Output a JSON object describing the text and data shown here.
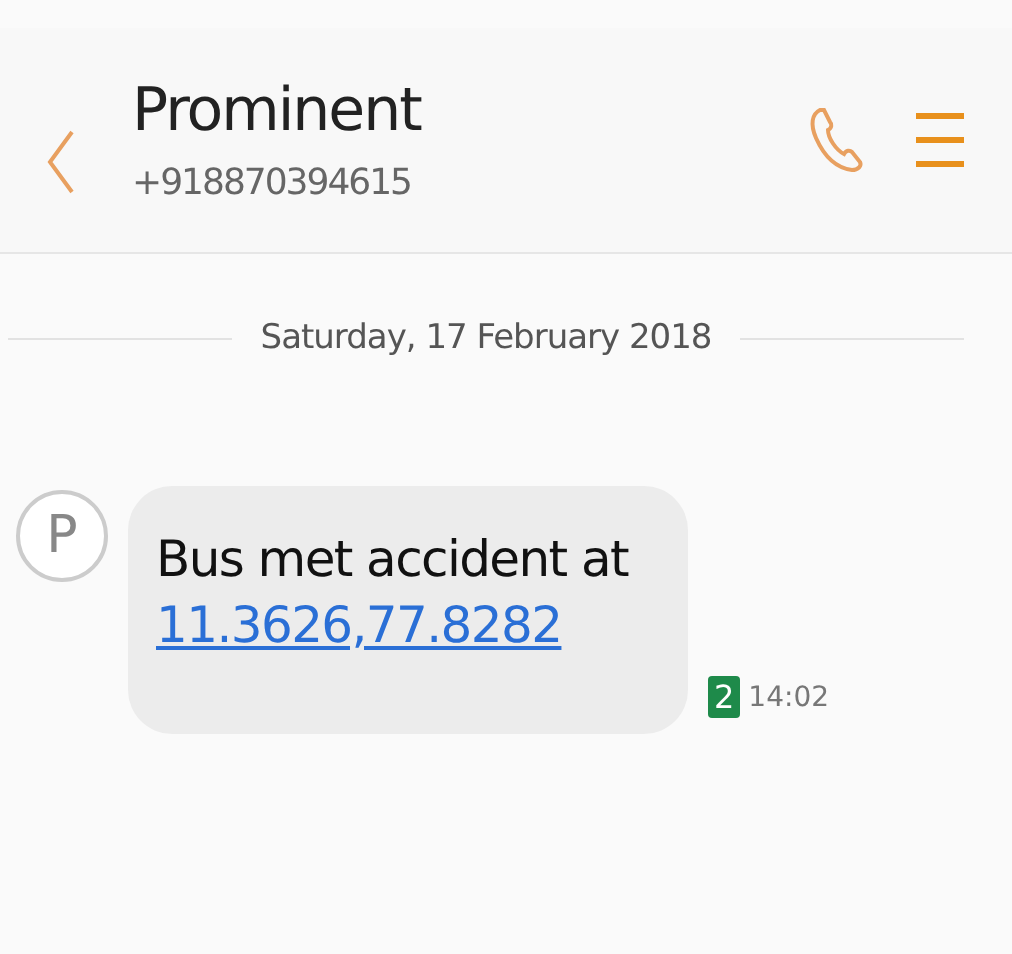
{
  "header": {
    "title": "Prominent",
    "subtitle": "+918870394615"
  },
  "date_separator": "Saturday, 17 February 2018",
  "messages": [
    {
      "avatar": "P",
      "text": "Bus met accident at",
      "link": "11.3626,77.8282",
      "sim": "2",
      "time": "14:02"
    }
  ]
}
